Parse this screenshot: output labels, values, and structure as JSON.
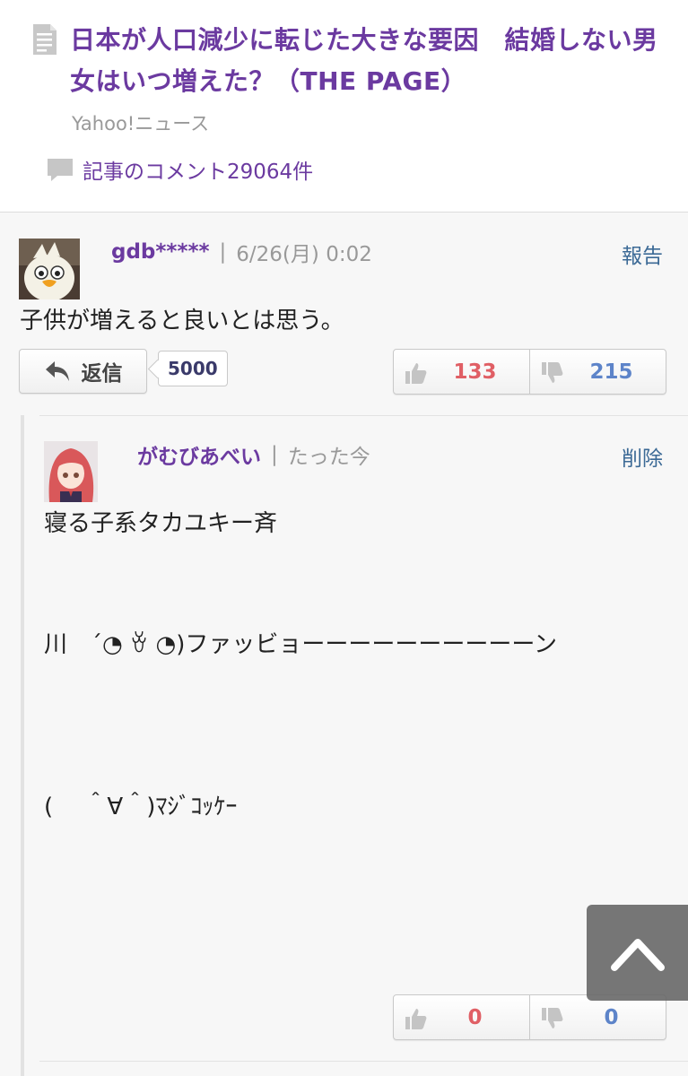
{
  "article": {
    "title": "日本が人口減少に転じた大きな要因　結婚しない男女はいつ増えた？（THE PAGE）",
    "source": "Yahoo!ニュース",
    "comment_link": "記事のコメント29064件"
  },
  "comment": {
    "username": "gdb*****",
    "separator": "|",
    "timestamp": "6/26(月) 0:02",
    "report_label": "報告",
    "text": "子供が増えると良いとは思う。",
    "reply_label": "返信",
    "reply_count": "5000",
    "good_count": "133",
    "bad_count": "215"
  },
  "reply": {
    "username": "がむびあべい",
    "separator": "|",
    "timestamp": "たった今",
    "delete_label": "削除",
    "line1": "寝る子系タカユキー斉",
    "line2": "川　´◔ ꈊ ◔)ファッビョーーーーーーーーーーン",
    "line3": "(　 ＾∀＾)ﾏｼﾞｺｯｹｰ",
    "good_count": "0",
    "bad_count": "0"
  },
  "icons": [
    "document-icon",
    "comment-bubble-icon",
    "reply-arrow-icon",
    "thumbs-up-icon",
    "thumbs-down-icon",
    "chevron-up-icon"
  ],
  "colors": {
    "title_purple": "#6b3aa0",
    "link_blue": "#3c6a96",
    "good_red": "#e05f65",
    "bad_blue": "#5d84c9"
  }
}
